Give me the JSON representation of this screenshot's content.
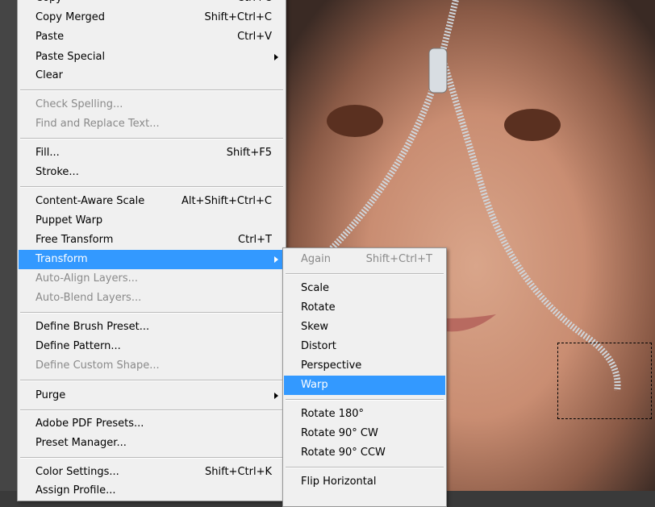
{
  "edit_menu": {
    "items": [
      {
        "label": "Copy",
        "shortcut": "Ctrl+C"
      },
      {
        "label": "Copy Merged",
        "shortcut": "Shift+Ctrl+C"
      },
      {
        "label": "Paste",
        "shortcut": "Ctrl+V"
      },
      {
        "label": "Paste Special",
        "shortcut": "",
        "submenu": true
      },
      {
        "label": "Clear",
        "shortcut": ""
      },
      {
        "label": "Check Spelling...",
        "shortcut": "",
        "disabled": true
      },
      {
        "label": "Find and Replace Text...",
        "shortcut": "",
        "disabled": true
      },
      {
        "label": "Fill...",
        "shortcut": "Shift+F5"
      },
      {
        "label": "Stroke...",
        "shortcut": ""
      },
      {
        "label": "Content-Aware Scale",
        "shortcut": "Alt+Shift+Ctrl+C"
      },
      {
        "label": "Puppet Warp",
        "shortcut": ""
      },
      {
        "label": "Free Transform",
        "shortcut": "Ctrl+T"
      },
      {
        "label": "Transform",
        "shortcut": "",
        "submenu": true,
        "highlighted": true
      },
      {
        "label": "Auto-Align Layers...",
        "shortcut": "",
        "disabled": true
      },
      {
        "label": "Auto-Blend Layers...",
        "shortcut": "",
        "disabled": true
      },
      {
        "label": "Define Brush Preset...",
        "shortcut": ""
      },
      {
        "label": "Define Pattern...",
        "shortcut": ""
      },
      {
        "label": "Define Custom Shape...",
        "shortcut": "",
        "disabled": true
      },
      {
        "label": "Purge",
        "shortcut": "",
        "submenu": true
      },
      {
        "label": "Adobe PDF Presets...",
        "shortcut": ""
      },
      {
        "label": "Preset Manager...",
        "shortcut": ""
      },
      {
        "label": "Color Settings...",
        "shortcut": "Shift+Ctrl+K"
      },
      {
        "label": "Assign Profile...",
        "shortcut": ""
      }
    ]
  },
  "transform_submenu": {
    "items": [
      {
        "label": "Again",
        "shortcut": "Shift+Ctrl+T",
        "disabled": true
      },
      {
        "label": "Scale",
        "shortcut": ""
      },
      {
        "label": "Rotate",
        "shortcut": ""
      },
      {
        "label": "Skew",
        "shortcut": ""
      },
      {
        "label": "Distort",
        "shortcut": ""
      },
      {
        "label": "Perspective",
        "shortcut": ""
      },
      {
        "label": "Warp",
        "shortcut": "",
        "highlighted": true
      },
      {
        "label": "Rotate 180°",
        "shortcut": ""
      },
      {
        "label": "Rotate 90° CW",
        "shortcut": ""
      },
      {
        "label": "Rotate 90° CCW",
        "shortcut": ""
      },
      {
        "label": "Flip Horizontal",
        "shortcut": ""
      }
    ]
  },
  "colors": {
    "highlight": "#3399ff",
    "menu_bg": "#f0f0f0"
  }
}
